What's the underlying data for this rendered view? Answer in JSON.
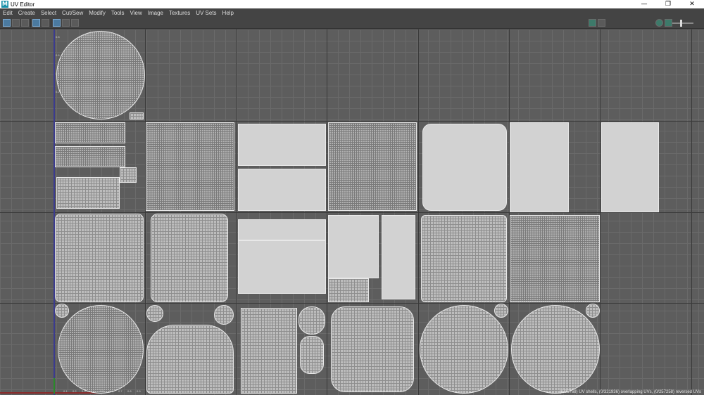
{
  "window": {
    "app_icon_letter": "M",
    "title": "UV Editor",
    "minimize_glyph": "—",
    "maximize_glyph": "❐",
    "close_glyph": "✕"
  },
  "menu": {
    "items": [
      "Edit",
      "Create",
      "Select",
      "Cut/Sew",
      "Modify",
      "Tools",
      "View",
      "Image",
      "Textures",
      "UV Sets",
      "Help"
    ]
  },
  "toolbar": {
    "left_icons": [
      "uv-tile-icon",
      "snapshot-icon",
      "texture-icon",
      "checker-icon",
      "grid-icon",
      "isolate-icon",
      "shaded-icon",
      "camera-icon"
    ],
    "right_icons": [
      "image-icon",
      "checker-pattern-icon",
      "dropdown-icon",
      "shading-icon",
      "display-icon"
    ]
  },
  "viewport": {
    "tick_labels_left": [
      "0.8",
      "0.6",
      "0.4",
      "0.2"
    ],
    "tick_labels_bottom": [
      "0.1",
      "0.2",
      "0.3",
      "0.4",
      "0.5",
      "0.6",
      "0.7",
      "0.8",
      "0.9"
    ]
  },
  "status": {
    "text": "(6/25768) UV shells, (0/321936) overlapping UVs, (0/257258) reversed UVs"
  }
}
